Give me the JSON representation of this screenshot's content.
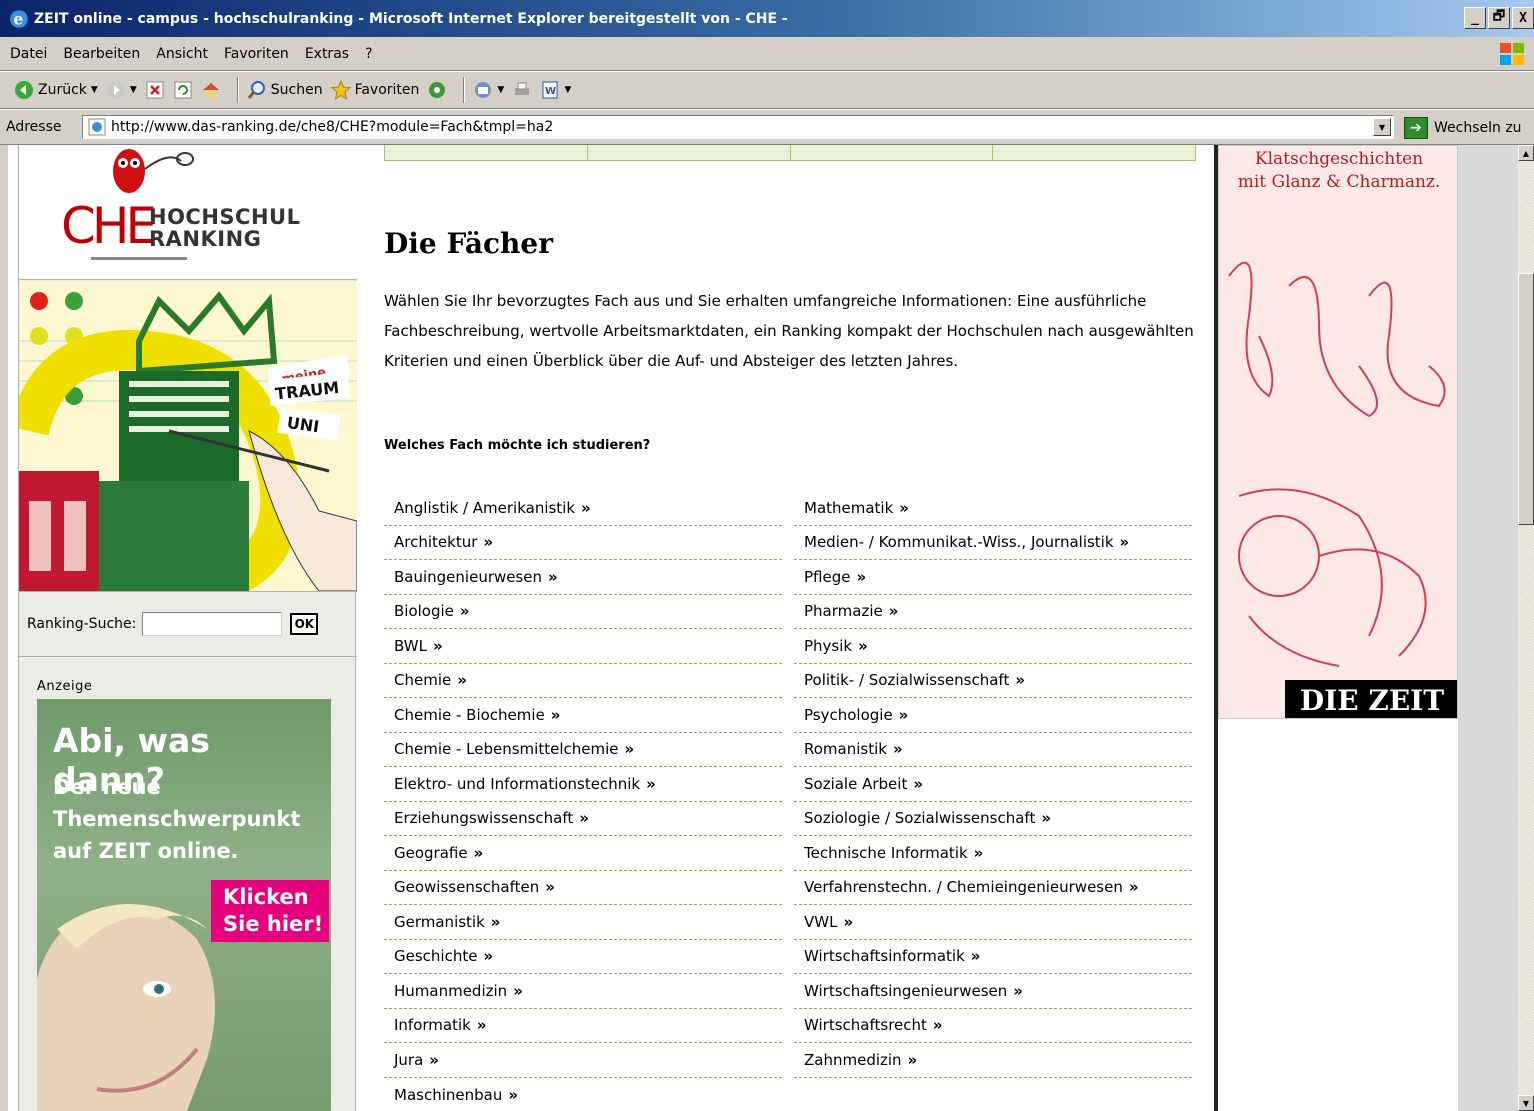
{
  "window": {
    "title": "ZEIT online - campus - hochschulranking - Microsoft Internet Explorer bereitgestellt von - CHE -",
    "controls": [
      "_",
      "🗗",
      "X"
    ]
  },
  "menu": [
    "Datei",
    "Bearbeiten",
    "Ansicht",
    "Favoriten",
    "Extras",
    "?"
  ],
  "toolbar": {
    "back": "Zurück",
    "search": "Suchen",
    "favorites": "Favoriten"
  },
  "address": {
    "label": "Adresse",
    "url": "http://www.das-ranking.de/che8/CHE?module=Fach&tmpl=ha2",
    "go": "Wechseln zu"
  },
  "sidebar": {
    "logo_che": "CHE",
    "logo_line1": "HOCHSCHUL",
    "logo_line2": "RANKING",
    "traum_meine": "meine",
    "traum_traum": "TRAUM",
    "traum_uni": "UNI",
    "search_label": "Ranking-Suche:",
    "search_value": "",
    "ok": "OK",
    "anzeige": "Anzeige",
    "ad_headline": "Abi, was dann?",
    "ad_subline": "Der neue Themenschwerpunkt auf ZEIT online.",
    "ad_cta_1": "Klicken",
    "ad_cta_2": "Sie hier!"
  },
  "main": {
    "title": "Die Fächer",
    "intro": "Wählen Sie Ihr bevorzugtes Fach aus und Sie erhalten umfangreiche Informationen: Eine ausführliche Fachbeschreibung, wertvolle Arbeitsmarktdaten, ein Ranking kompakt der Hochschulen nach ausgewählten Kriterien und einen Überblick über die Auf- und Absteiger des letzten Jahres.",
    "question": "Welches Fach möchte ich studieren?",
    "raquo": "»",
    "subjects_left": [
      "Anglistik / Amerikanistik",
      "Architektur",
      "Bauingenieurwesen",
      "Biologie",
      "BWL",
      "Chemie",
      "Chemie - Biochemie",
      "Chemie - Lebensmittelchemie",
      "Elektro- und Informationstechnik",
      "Erziehungswissenschaft",
      "Geografie",
      "Geowissenschaften",
      "Germanistik",
      "Geschichte",
      "Humanmedizin",
      "Informatik",
      "Jura",
      "Maschinenbau"
    ],
    "subjects_right": [
      "Mathematik",
      "Medien- / Kommunikat.-Wiss., Journalistik",
      "Pflege",
      "Pharmazie",
      "Physik",
      "Politik- / Sozialwissenschaft",
      "Psychologie",
      "Romanistik",
      "Soziale Arbeit",
      "Soziologie / Sozialwissenschaft",
      "Technische Informatik",
      "Verfahrenstechn. / Chemieingenieurwesen",
      "VWL",
      "Wirtschaftsinformatik",
      "Wirtschaftsingenieurwesen",
      "Wirtschaftsrecht",
      "Zahnmedizin"
    ]
  },
  "right_ad": {
    "line1": "Klatschgeschichten",
    "line2": "mit Glanz & Charmanz.",
    "logo": "DIE ZEIT"
  },
  "colors": {
    "title_bar_start": "#0a246a",
    "list_divider": "#9aa84e",
    "nav_border": "#a6c46e",
    "ad_pink": "#e6007e",
    "che_red": "#c00000"
  }
}
